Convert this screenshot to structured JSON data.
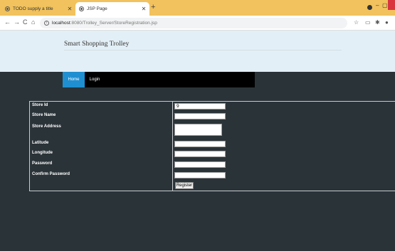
{
  "browser": {
    "tabs": [
      {
        "title": "TODO supply a title",
        "active": false
      },
      {
        "title": "JSP Page",
        "active": true
      }
    ],
    "new_tab": "+",
    "address": {
      "host": "localhost",
      "path": ":8080/Trolley_Server/StoreRegistration.jsp"
    },
    "nav_glyphs": {
      "back": "←",
      "forward": "→",
      "reload": "C",
      "home": "⌂"
    },
    "toolbar_glyphs": {
      "star": "☆",
      "extensions": "✱"
    },
    "window_glyphs": {
      "minimize": "–",
      "maximize": "▢"
    }
  },
  "site": {
    "title": "Smart Shopping Trolley",
    "nav": {
      "home": "Home",
      "login": "Login"
    }
  },
  "form": {
    "fields": [
      {
        "label": "Store Id",
        "value": "9"
      },
      {
        "label": "Store Name",
        "value": ""
      },
      {
        "label": "Store Address",
        "value": ""
      },
      {
        "label": "Latitude",
        "value": ""
      },
      {
        "label": "Longitude",
        "value": ""
      },
      {
        "label": "Password",
        "value": ""
      },
      {
        "label": "Confirm Password",
        "value": ""
      }
    ],
    "submit_label": "Register"
  },
  "colors": {
    "tab_strip": "#f1c25d",
    "header_bg": "#e3eff6",
    "page_bg": "#2a3338",
    "nav_active": "#1f8fd1",
    "nav_bg": "#000000"
  }
}
